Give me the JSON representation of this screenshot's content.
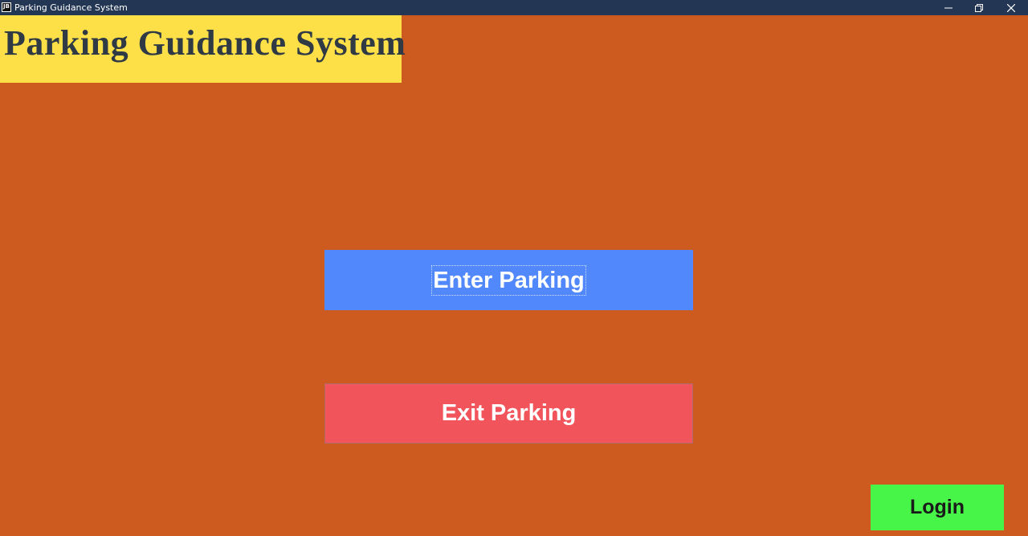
{
  "window": {
    "title": "Parking Guidance System",
    "icon_label": "JB",
    "controls": {
      "minimize": "minimize-icon",
      "restore": "restore-icon",
      "close": "close-icon"
    }
  },
  "header": {
    "title": "Parking Guidance System"
  },
  "actions": {
    "enter_label": "Enter Parking",
    "exit_label": "Exit Parking",
    "login_label": "Login"
  },
  "colors": {
    "background": "#cd5b1f",
    "title_panel": "#fde047",
    "enter_button": "#5188fb",
    "exit_button": "#f2545b",
    "login_button": "#47f548",
    "titlebar": "#233755"
  }
}
